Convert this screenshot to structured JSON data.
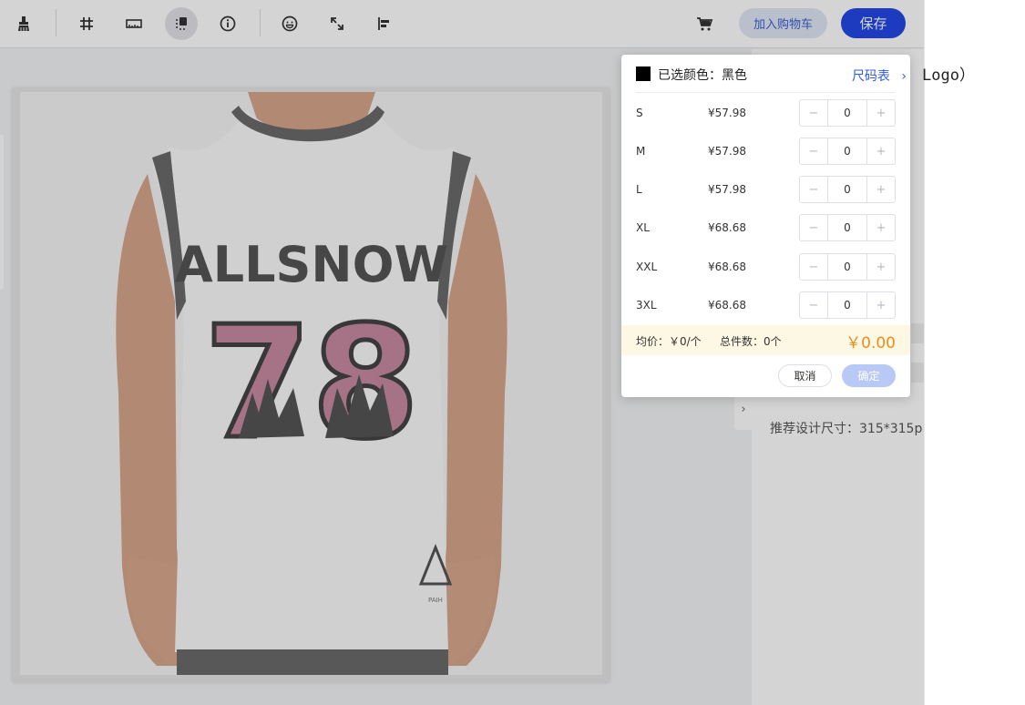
{
  "toolbar": {
    "icons": [
      "brush-icon",
      "hash-icon",
      "ruler-icon",
      "layer-icon",
      "info-icon",
      "emoji-icon",
      "expand-icon",
      "align-left-icon"
    ],
    "add_cart_label": "加入购物车",
    "save_label": "保存"
  },
  "side_panel": {
    "logo_text": "Logo）",
    "recommend_size": "推荐设计尺寸：315*315p",
    "collapse_glyph": "›"
  },
  "product": {
    "print_text": "ALLSNOW",
    "print_number": "78",
    "brand_mark": "PAIH"
  },
  "popup": {
    "selected_color_label": "已选颜色：黑色",
    "swatch_color": "#000000",
    "size_chart_label": "尺码表",
    "size_chart_arrow": "›",
    "rows": [
      {
        "size": "S",
        "price": "¥57.98",
        "qty": "0"
      },
      {
        "size": "M",
        "price": "¥57.98",
        "qty": "0"
      },
      {
        "size": "L",
        "price": "¥57.98",
        "qty": "0"
      },
      {
        "size": "XL",
        "price": "¥68.68",
        "qty": "0"
      },
      {
        "size": "XXL",
        "price": "¥68.68",
        "qty": "0"
      },
      {
        "size": "3XL",
        "price": "¥68.68",
        "qty": "0"
      }
    ],
    "minus_glyph": "−",
    "plus_glyph": "+",
    "avg_price": "均价：￥0/个",
    "total_count": "总件数：0个",
    "total_price": "￥0.00",
    "cancel_label": "取消",
    "confirm_label": "确定"
  },
  "colors": {
    "primary": "#2448e6",
    "accent_orange": "#f08c1a"
  }
}
